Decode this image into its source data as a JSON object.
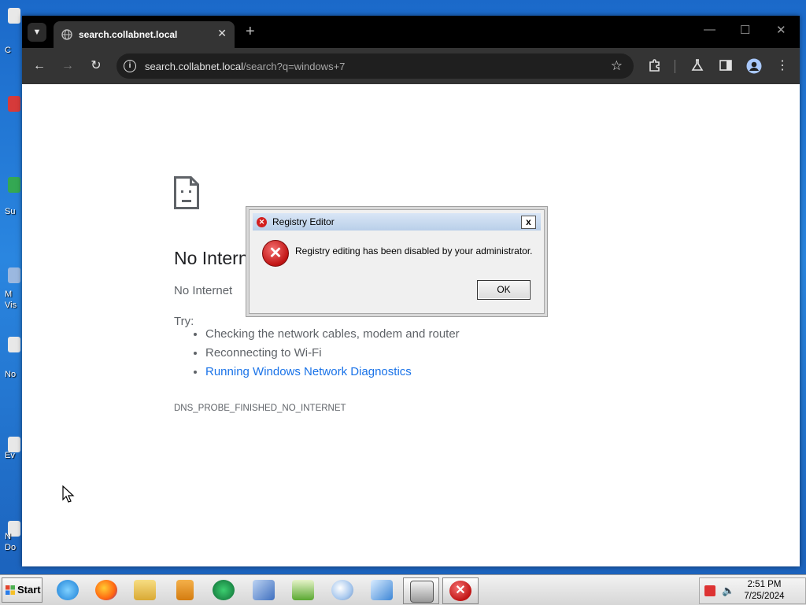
{
  "browser": {
    "tab_title": "search.collabnet.local",
    "address": {
      "host": "search.collabnet.local",
      "path": "/search?q=windows+7"
    }
  },
  "error_page": {
    "title": "No Internet",
    "subtitle": "No Internet",
    "try_label": "Try:",
    "tips": [
      "Checking the network cables, modem and router",
      "Reconnecting to Wi-Fi",
      "Running Windows Network Diagnostics"
    ],
    "error_code": "DNS_PROBE_FINISHED_NO_INTERNET"
  },
  "dialog": {
    "title": "Registry Editor",
    "message": "Registry editing has been disabled by your administrator.",
    "ok_label": "OK",
    "close_label": "x"
  },
  "taskbar": {
    "start_label": "Start",
    "clock": {
      "time": "2:51 PM",
      "date": "7/25/2024"
    }
  },
  "desktop_icons": [
    {
      "label": "C"
    },
    {
      "label": "Su"
    },
    {
      "label": "M"
    },
    {
      "label": "Vis"
    },
    {
      "label": "No"
    },
    {
      "label": "Ev"
    },
    {
      "label": "N"
    },
    {
      "label": "Do"
    }
  ],
  "colors": {
    "desktop_bg": "#1b69c9",
    "tab_bg": "#343434",
    "link": "#1a73e8",
    "error_red": "#c01414"
  }
}
